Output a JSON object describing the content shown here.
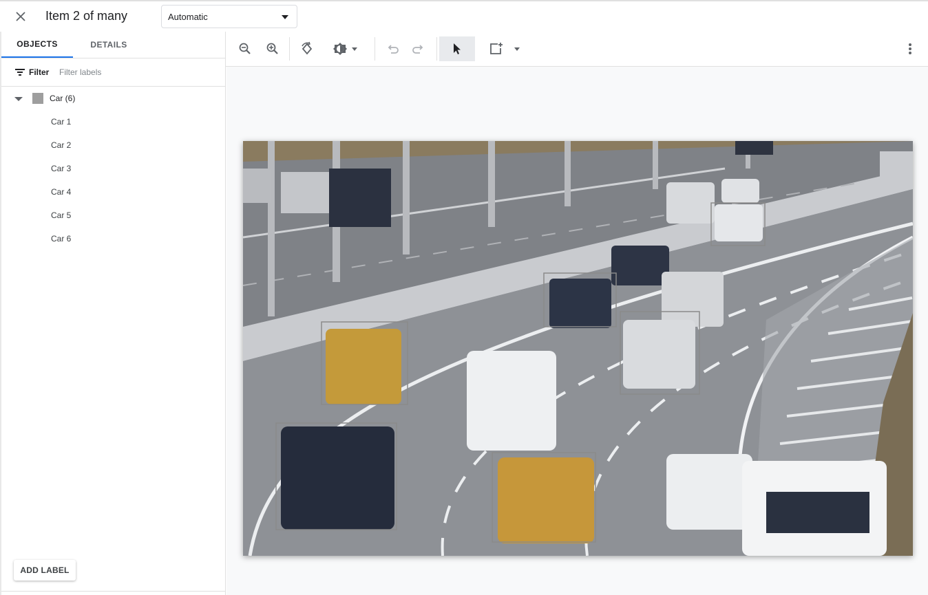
{
  "header": {
    "title": "Item 2 of many",
    "mode_select": {
      "value": "Automatic"
    },
    "close_icon": "close-icon"
  },
  "sidebar": {
    "tabs": [
      {
        "label": "OBJECTS",
        "active": true
      },
      {
        "label": "DETAILS",
        "active": false
      }
    ],
    "filter": {
      "label": "Filter",
      "placeholder": "Filter labels"
    },
    "groups": [
      {
        "label": "Car (6)",
        "color": "#9e9e9e",
        "expanded": true,
        "items": [
          "Car 1",
          "Car 2",
          "Car 3",
          "Car 4",
          "Car 5",
          "Car 6"
        ]
      }
    ],
    "add_label_button": "ADD LABEL"
  },
  "toolbar": {
    "tools": [
      {
        "icon": "zoom-out-icon"
      },
      {
        "icon": "zoom-in-icon"
      },
      {
        "icon": "rotate-icon"
      },
      {
        "icon": "brightness-icon",
        "dropdown": true
      },
      {
        "icon": "undo-icon",
        "enabled": false
      },
      {
        "icon": "redo-icon",
        "enabled": false
      },
      {
        "icon": "pointer-icon",
        "selected": true
      },
      {
        "icon": "bounding-box-icon",
        "dropdown": true
      },
      {
        "icon": "more-vert-icon"
      }
    ]
  },
  "image": {
    "description_icon": "road-traffic-photo",
    "annotation_box_color": "#8a8a8a",
    "annotation_count": 6
  }
}
